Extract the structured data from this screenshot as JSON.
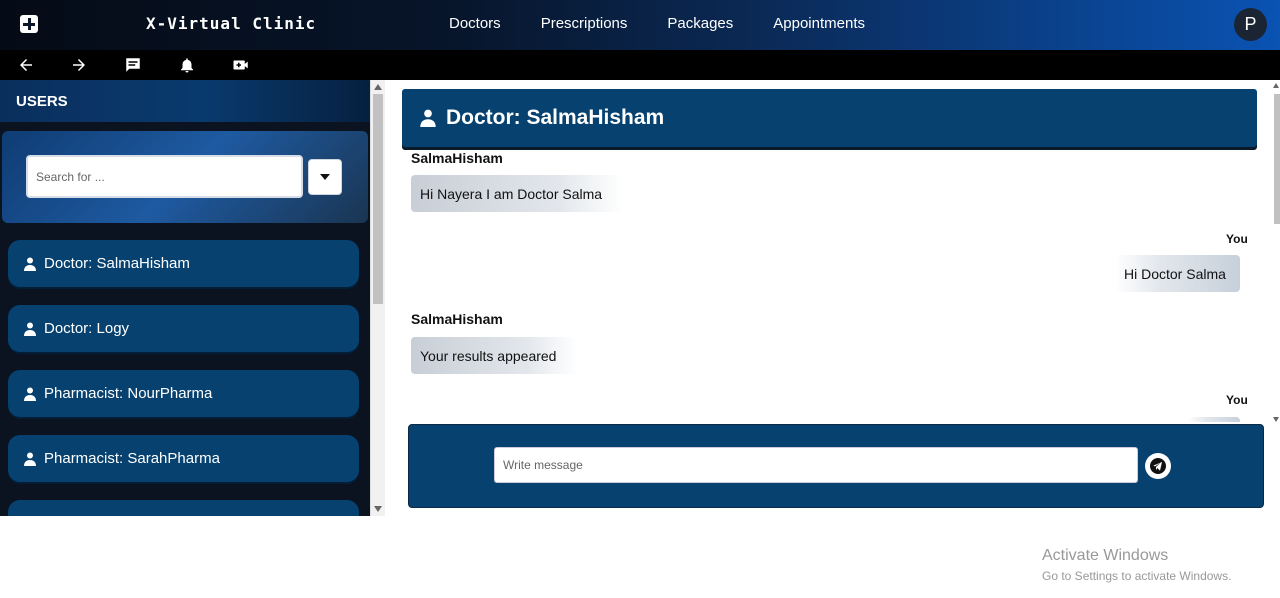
{
  "app": {
    "brand": "X-Virtual Clinic",
    "avatar_letter": "P"
  },
  "nav": [
    {
      "label": "Doctors"
    },
    {
      "label": "Prescriptions"
    },
    {
      "label": "Packages"
    },
    {
      "label": "Appointments"
    }
  ],
  "toolbar": {
    "icons": [
      "back-arrow-icon",
      "forward-arrow-icon",
      "chat-icon",
      "bell-icon",
      "video-call-icon"
    ]
  },
  "sidebar": {
    "title": "USERS",
    "search_placeholder": "Search for ...",
    "users": [
      {
        "label": "Doctor: SalmaHisham"
      },
      {
        "label": "Doctor: Logy"
      },
      {
        "label": "Pharmacist: NourPharma"
      },
      {
        "label": "Pharmacist: SarahPharma"
      }
    ]
  },
  "chat": {
    "title": "Doctor: SalmaHisham",
    "messages": [
      {
        "sender": "SalmaHisham",
        "text": "Hi Nayera I am Doctor Salma",
        "from": "them"
      },
      {
        "sender": "You",
        "text": "Hi Doctor Salma",
        "from": "me"
      },
      {
        "sender": "SalmaHisham",
        "text": "Your results appeared",
        "from": "them"
      },
      {
        "sender": "You",
        "text": "",
        "from": "me"
      }
    ],
    "input_placeholder": "Write message"
  },
  "watermark": {
    "title": "Activate Windows",
    "subtitle": "Go to Settings to activate Windows."
  },
  "colors": {
    "primary": "#06416f",
    "topbar_dark": "#050b16",
    "topbar_accent": "#0a53b3"
  }
}
